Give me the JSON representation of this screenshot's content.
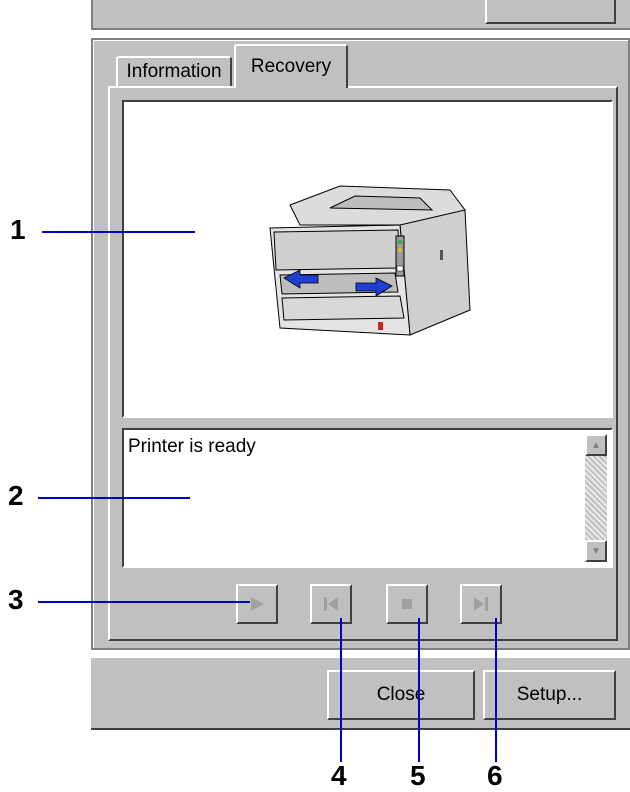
{
  "tabs": [
    {
      "label": "Information",
      "active": false
    },
    {
      "label": "Recovery",
      "active": true
    }
  ],
  "status": {
    "message": "Printer is ready"
  },
  "controls": [
    {
      "name": "play",
      "icon": "play-icon"
    },
    {
      "name": "previous",
      "icon": "skip-back-icon"
    },
    {
      "name": "stop",
      "icon": "stop-icon"
    },
    {
      "name": "next",
      "icon": "skip-forward-icon"
    }
  ],
  "footer": {
    "close_label": "Close",
    "setup_label": "Setup..."
  },
  "callouts": [
    "1",
    "2",
    "3",
    "4",
    "5",
    "6"
  ],
  "colors": {
    "face": "#c0c0c0",
    "callout_line": "#0000cc",
    "arrow_blue": "#1f3fd0"
  }
}
